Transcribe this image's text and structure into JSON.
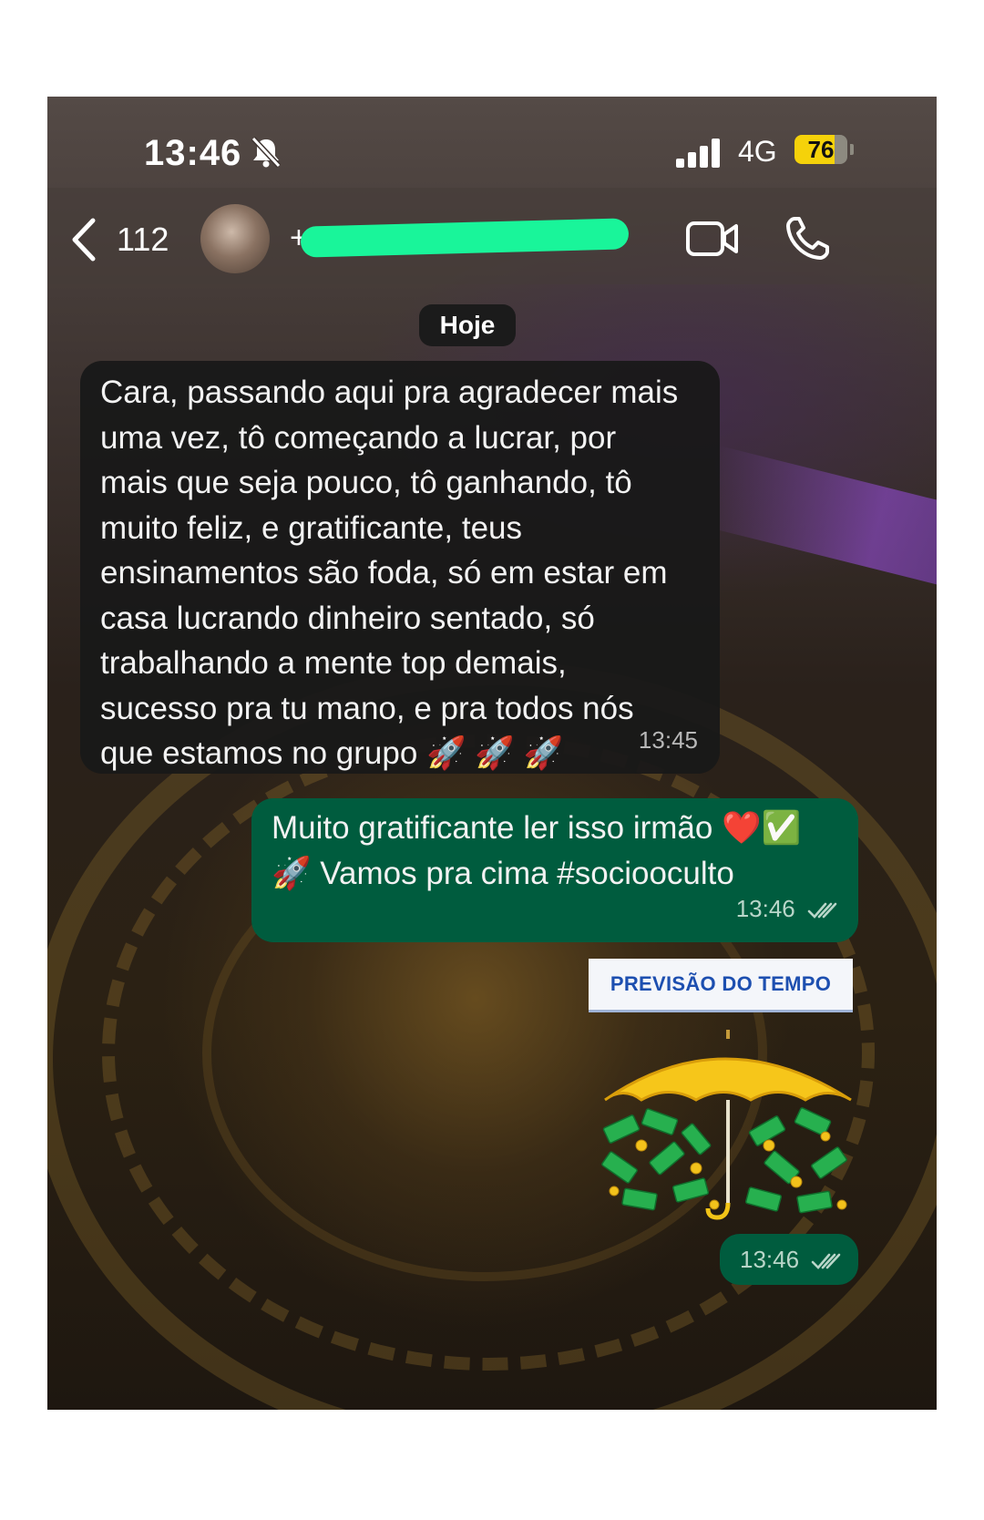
{
  "status_bar": {
    "time": "13:46",
    "network": "4G",
    "battery": "76"
  },
  "header": {
    "back_count": "112",
    "contact_prefix": "+"
  },
  "date_chip": "Hoje",
  "messages": {
    "incoming": {
      "lines": [
        "Cara, passando aqui pra agradecer mais",
        "uma vez, tô começando a lucrar, por",
        "mais que seja pouco, tô ganhando, tô",
        "muito feliz, e gratificante, teus",
        "ensinamentos são foda, só em estar em",
        "casa lucrando dinheiro sentado, só",
        "trabalhando a mente top demais,",
        "sucesso pra tu mano, e pra todos nós",
        "que estamos no grupo 🚀 🚀 🚀"
      ],
      "time": "13:45"
    },
    "outgoing": {
      "lines": [
        "Muito gratificante ler isso irmão ❤️✅",
        "🚀  Vamos pra cima #sociooculto"
      ],
      "time": "13:46"
    },
    "sticker": {
      "banner": "PREVISÃO DO TEMPO",
      "time": "13:46"
    }
  },
  "colors": {
    "incoming_bubble": "#181818",
    "outgoing_bubble": "#005c3e",
    "redaction": "#19f59a",
    "battery": "#f5d20a"
  }
}
